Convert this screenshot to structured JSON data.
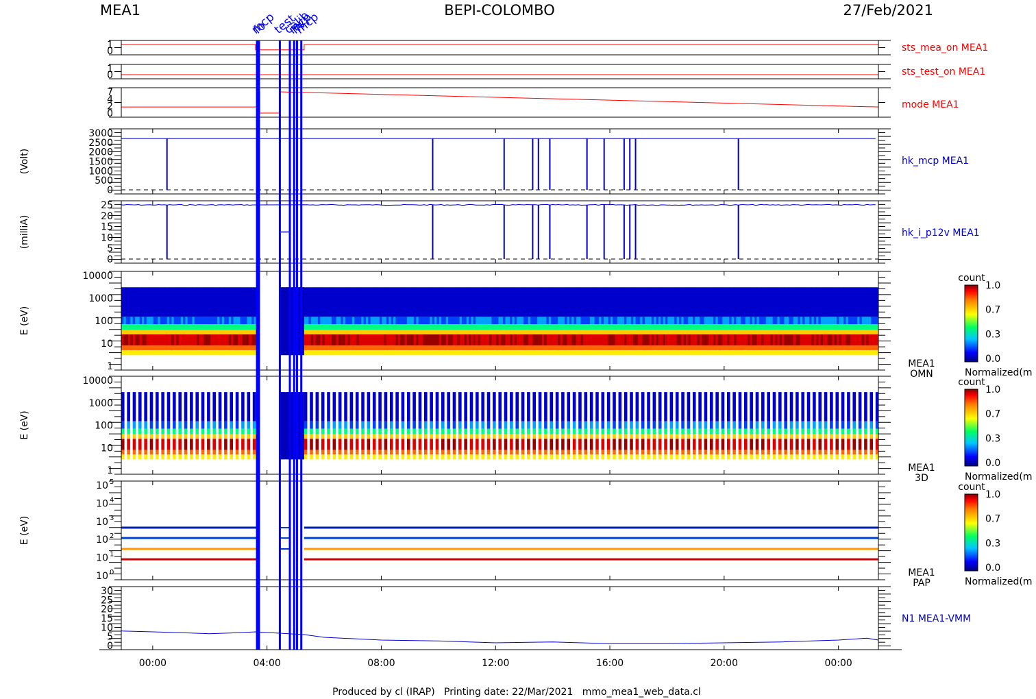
{
  "header": {
    "instrument": "MEA1",
    "mission": "BEPI-COLOMBO",
    "date": "27/Feb/2021"
  },
  "footer": {
    "credits": "Produced by cl (IRAP)   Printing date: 22/Mar/2021   mmo_mea1_web_data.cl"
  },
  "colors": {
    "hk_red": "#ff0000",
    "series_blue": "#0000cc",
    "marker_blue": "#0000ff",
    "axis": "#000000"
  },
  "time_axis": {
    "unit": "hours",
    "range": [
      -1.1,
      25.4
    ],
    "tick_labels": [
      "00:00",
      "04:00",
      "08:00",
      "12:00",
      "16:00",
      "20:00",
      "00:00"
    ],
    "tick_hours": [
      0,
      4,
      8,
      12,
      16,
      20,
      24
    ]
  },
  "event_markers": {
    "labels": [
      "mcp",
      "fo",
      "test",
      "calib",
      "mcp",
      "hv",
      "mcp"
    ],
    "hours": [
      3.65,
      3.72,
      4.45,
      4.8,
      4.95,
      5.05,
      5.2
    ],
    "gap": [
      3.7,
      4.45
    ]
  },
  "chart_data": [
    {
      "type": "line",
      "name": "sts_mea_on MEA1",
      "yticks": [
        "1",
        "0"
      ],
      "ylim": [
        0,
        1
      ],
      "x": [
        -1.1,
        3.6,
        3.6,
        5.3,
        5.3,
        25.4
      ],
      "y": [
        1,
        1,
        0.15,
        0.15,
        1,
        1
      ]
    },
    {
      "type": "line",
      "name": "sts_test_on MEA1",
      "yticks": [
        "1",
        "0"
      ],
      "ylim": [
        0,
        1
      ],
      "x": [
        -1.1,
        25.4
      ],
      "y": [
        0,
        0
      ]
    },
    {
      "type": "line",
      "name": "mode MEA1",
      "yticks": [
        "7",
        "4",
        "2",
        "0"
      ],
      "ylim": [
        0,
        7
      ],
      "x": [
        -1.1,
        3.65,
        3.65,
        3.75,
        3.75,
        4.45,
        4.45,
        25.4
      ],
      "y": [
        2,
        2,
        7,
        7,
        0,
        0,
        7,
        2
      ]
    },
    {
      "type": "line",
      "name": "hk_mcp MEA1",
      "ylabel": "(Volt)",
      "yticks": [
        "3000",
        "2500",
        "2000",
        "1500",
        "1000",
        "500",
        "0"
      ],
      "ylim": [
        0,
        3000
      ],
      "baseline": 0,
      "level": 2700,
      "dropouts": [
        0.5,
        9.8,
        12.3,
        13.3,
        13.5,
        13.9,
        15.2,
        15.8,
        16.5,
        16.7,
        16.9,
        20.5
      ]
    },
    {
      "type": "line",
      "name": "hk_i_p12v MEA1",
      "ylabel": "(milliA)",
      "yticks": [
        "25",
        "20",
        "15",
        "10",
        "5",
        "0"
      ],
      "ylim": [
        0,
        25
      ],
      "baseline": 0,
      "level": 25,
      "level_in_gap": 12.5,
      "dropouts": [
        0.5,
        9.8,
        12.3,
        13.3,
        13.5,
        13.9,
        15.2,
        15.8,
        16.5,
        16.7,
        16.9,
        20.5
      ]
    },
    {
      "type": "heatmap",
      "name": "MEA1 OMN",
      "ylabel": "E (eV)",
      "scale": "log",
      "yticks": [
        "10000",
        "1000",
        "100",
        "10",
        "1"
      ],
      "ylim": [
        1,
        10000
      ],
      "energy_range": [
        3,
        3000
      ],
      "colorbar": {
        "label": "count",
        "ticks": [
          "1.0",
          "0.7",
          "0.3",
          "0.0"
        ],
        "caption": "Normalized(m"
      }
    },
    {
      "type": "heatmap",
      "name": "MEA1 3D",
      "ylabel": "E (eV)",
      "scale": "log",
      "yticks": [
        "10000",
        "1000",
        "100",
        "10",
        "1"
      ],
      "ylim": [
        1,
        10000
      ],
      "energy_range": [
        3,
        3000
      ],
      "pattern": "striped",
      "colorbar": {
        "label": "count",
        "ticks": [
          "1.0",
          "0.7",
          "0.3",
          "0.0"
        ],
        "caption": "Normalized(m"
      }
    },
    {
      "type": "heatmap",
      "name": "MEA1 PAP",
      "ylabel": "E (eV)",
      "scale": "log",
      "yticks": [
        "10",
        "10",
        "10",
        "10",
        "10",
        "10"
      ],
      "ytick_exponents": [
        "5",
        "4",
        "3",
        "2",
        "1",
        "0"
      ],
      "ylim": [
        1,
        100000
      ],
      "lines": [
        {
          "energy": 450,
          "color": "#0022aa"
        },
        {
          "energy": 120,
          "color": "#0044cc"
        },
        {
          "energy": 30,
          "color": "#ff9900"
        },
        {
          "energy": 8,
          "color": "#cc0000"
        }
      ],
      "colorbar": {
        "label": "count",
        "ticks": [
          "1.0",
          "0.7",
          "0.3",
          "0.0"
        ],
        "caption": "Normalized(m"
      }
    },
    {
      "type": "line",
      "name": "N1 MEA1-VMM",
      "yticks": [
        "30",
        "25",
        "20",
        "15",
        "10",
        "5",
        "0"
      ],
      "ylim": [
        0,
        30
      ],
      "x": [
        -1.1,
        0,
        1,
        2,
        3,
        3.6,
        5.3,
        6,
        8,
        10,
        12,
        14,
        16,
        18,
        20,
        22,
        24,
        25,
        25.4
      ],
      "y": [
        8,
        7.5,
        7,
        6.5,
        7,
        7.5,
        6,
        4.5,
        3,
        2.5,
        1.5,
        2,
        1,
        1,
        1.5,
        2,
        3,
        4,
        3
      ]
    }
  ]
}
